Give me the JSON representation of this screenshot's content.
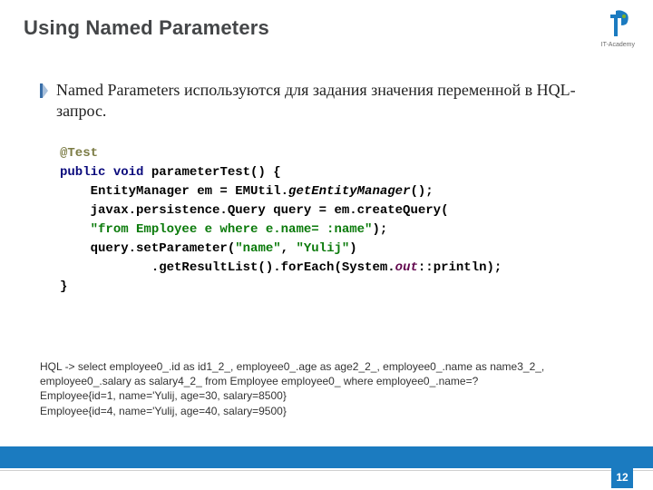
{
  "header": {
    "title": "Using Named Parameters",
    "logo_caption": "IT-Academy"
  },
  "body": {
    "para": "Named Parameters используются для задания значения переменной в HQL-запрос."
  },
  "code": {
    "l1": "@Test",
    "l2a": "public",
    "l2b": "void",
    "l2c": " parameterTest() {",
    "l3a": "    EntityManager em = EMUtil.",
    "l3b": "getEntityManager",
    "l3c": "();",
    "l4": "    javax.persistence.Query query = em.createQuery(",
    "l5a": "    ",
    "l5b": "\"from Employee e where e.name= :name\"",
    "l5c": ");",
    "l6a": "    query.setParameter(",
    "l6b": "\"name\"",
    "l6c": ", ",
    "l6d": "\"Yulij\"",
    "l6e": ")",
    "l7a": "            .getResultList().forEach(System.",
    "l7b": "out",
    "l7c": "::println);",
    "l8": "}"
  },
  "output": {
    "o1": "HQL -> select employee0_.id as id1_2_, employee0_.age as age2_2_, employee0_.name as name3_2_, employee0_.salary as salary4_2_ from Employee employee0_ where employee0_.name=?",
    "o2": "Employee{id=1, name='Yulij, age=30, salary=8500}",
    "o3": "Employee{id=4, name='Yulij, age=40, salary=9500}"
  },
  "page": {
    "number": "12"
  }
}
